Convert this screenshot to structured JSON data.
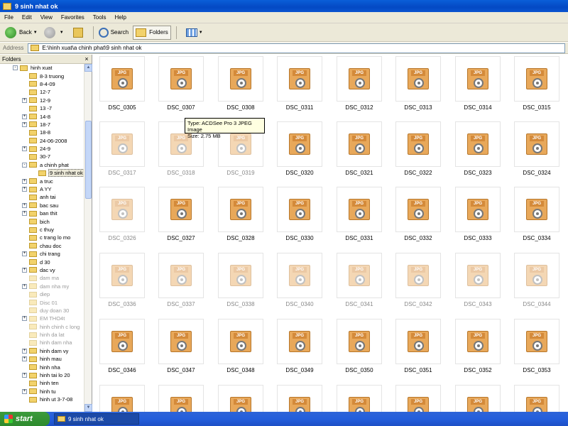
{
  "window": {
    "title": "9 sinh nhat ok"
  },
  "menu": [
    "File",
    "Edit",
    "View",
    "Favorites",
    "Tools",
    "Help"
  ],
  "toolbar": {
    "back": "Back",
    "search": "Search",
    "folders": "Folders"
  },
  "address": {
    "label": "Address",
    "path": "E:\\hinh xuat\\a chinh phat\\9 sinh nhat ok"
  },
  "folders_pane": {
    "title": "Folders",
    "close": "×"
  },
  "tree": [
    {
      "label": "hinh xuat",
      "level": 0,
      "expander": "-",
      "faded": false,
      "selected": false
    },
    {
      "label": "8-3 truong",
      "level": 1,
      "expander": "",
      "faded": false,
      "selected": false
    },
    {
      "label": "8-4-09",
      "level": 1,
      "expander": "",
      "faded": false,
      "selected": false
    },
    {
      "label": "12-7",
      "level": 1,
      "expander": "",
      "faded": false,
      "selected": false
    },
    {
      "label": "12-9",
      "level": 1,
      "expander": "+",
      "faded": false,
      "selected": false
    },
    {
      "label": "13 -7",
      "level": 1,
      "expander": "",
      "faded": false,
      "selected": false
    },
    {
      "label": "14-8",
      "level": 1,
      "expander": "+",
      "faded": false,
      "selected": false
    },
    {
      "label": "18-7",
      "level": 1,
      "expander": "+",
      "faded": false,
      "selected": false
    },
    {
      "label": "18-8",
      "level": 1,
      "expander": "",
      "faded": false,
      "selected": false
    },
    {
      "label": "24-06-2008",
      "level": 1,
      "expander": "",
      "faded": false,
      "selected": false
    },
    {
      "label": "24-9",
      "level": 1,
      "expander": "+",
      "faded": false,
      "selected": false
    },
    {
      "label": "30-7",
      "level": 1,
      "expander": "",
      "faded": false,
      "selected": false
    },
    {
      "label": "a chinh phat",
      "level": 1,
      "expander": "-",
      "faded": false,
      "selected": false
    },
    {
      "label": "9 sinh nhat ok",
      "level": 2,
      "expander": "",
      "faded": false,
      "selected": true
    },
    {
      "label": "a truc",
      "level": 1,
      "expander": "+",
      "faded": false,
      "selected": false
    },
    {
      "label": "A YY",
      "level": 1,
      "expander": "+",
      "faded": false,
      "selected": false
    },
    {
      "label": "anh tai",
      "level": 1,
      "expander": "",
      "faded": false,
      "selected": false
    },
    {
      "label": "bac sau",
      "level": 1,
      "expander": "+",
      "faded": false,
      "selected": false
    },
    {
      "label": "ban thit",
      "level": 1,
      "expander": "+",
      "faded": false,
      "selected": false
    },
    {
      "label": "bich",
      "level": 1,
      "expander": "",
      "faded": false,
      "selected": false
    },
    {
      "label": "c thuy",
      "level": 1,
      "expander": "",
      "faded": false,
      "selected": false
    },
    {
      "label": "c trang lo mo",
      "level": 1,
      "expander": "",
      "faded": false,
      "selected": false
    },
    {
      "label": "chau doc",
      "level": 1,
      "expander": "",
      "faded": false,
      "selected": false
    },
    {
      "label": "chi trang",
      "level": 1,
      "expander": "+",
      "faded": false,
      "selected": false
    },
    {
      "label": "d 30",
      "level": 1,
      "expander": "",
      "faded": false,
      "selected": false
    },
    {
      "label": "dac vy",
      "level": 1,
      "expander": "+",
      "faded": false,
      "selected": false
    },
    {
      "label": "dam ma",
      "level": 1,
      "expander": "",
      "faded": true,
      "selected": false
    },
    {
      "label": "dam nha my",
      "level": 1,
      "expander": "+",
      "faded": true,
      "selected": false
    },
    {
      "label": "diep",
      "level": 1,
      "expander": "",
      "faded": true,
      "selected": false
    },
    {
      "label": "Disc 01",
      "level": 1,
      "expander": "",
      "faded": true,
      "selected": false
    },
    {
      "label": "duy doan 30",
      "level": 1,
      "expander": "",
      "faded": true,
      "selected": false
    },
    {
      "label": "EM THO4t",
      "level": 1,
      "expander": "+",
      "faded": true,
      "selected": false
    },
    {
      "label": "hinh chinh c long",
      "level": 1,
      "expander": "",
      "faded": true,
      "selected": false
    },
    {
      "label": "hinh da lat",
      "level": 1,
      "expander": "",
      "faded": true,
      "selected": false
    },
    {
      "label": "hinh dam nha",
      "level": 1,
      "expander": "",
      "faded": true,
      "selected": false
    },
    {
      "label": "hinh dam vy",
      "level": 1,
      "expander": "+",
      "faded": false,
      "selected": false
    },
    {
      "label": "hinh mau",
      "level": 1,
      "expander": "+",
      "faded": false,
      "selected": false
    },
    {
      "label": "hinh nha",
      "level": 1,
      "expander": "",
      "faded": false,
      "selected": false
    },
    {
      "label": "hinh tai lo 20",
      "level": 1,
      "expander": "+",
      "faded": false,
      "selected": false
    },
    {
      "label": "hinh ten",
      "level": 1,
      "expander": "",
      "faded": false,
      "selected": false
    },
    {
      "label": "hinh tu",
      "level": 1,
      "expander": "+",
      "faded": false,
      "selected": false
    },
    {
      "label": "hinh ut 3-7-08",
      "level": 1,
      "expander": "",
      "faded": false,
      "selected": false
    }
  ],
  "thumb_badge": "JPG",
  "files": [
    [
      "DSC_0305",
      "DSC_0307",
      "DSC_0308",
      "DSC_0311",
      "DSC_0312",
      "DSC_0313",
      "DSC_0314",
      "DSC_0315"
    ],
    [
      "DSC_0317",
      "DSC_0318",
      "DSC_0319",
      "DSC_0320",
      "DSC_0321",
      "DSC_0322",
      "DSC_0323",
      "DSC_0324"
    ],
    [
      "DSC_0326",
      "DSC_0327",
      "DSC_0328",
      "DSC_0330",
      "DSC_0331",
      "DSC_0332",
      "DSC_0333",
      "DSC_0334"
    ],
    [
      "DSC_0336",
      "DSC_0337",
      "DSC_0338",
      "DSC_0340",
      "DSC_0341",
      "DSC_0342",
      "DSC_0343",
      "DSC_0344"
    ],
    [
      "DSC_0346",
      "DSC_0347",
      "DSC_0348",
      "DSC_0349",
      "DSC_0350",
      "DSC_0351",
      "DSC_0352",
      "DSC_0353"
    ],
    [
      "",
      "",
      "",
      "",
      "",
      "",
      "",
      ""
    ]
  ],
  "faded_rows": [
    3
  ],
  "faded_cells": [
    "1-0",
    "1-1",
    "1-2",
    "2-0"
  ],
  "tooltip": {
    "type": "Type: ACDSee Pro 3 JPEG Image",
    "size": "Size: 2.75 MB"
  },
  "taskbar": {
    "start": "start",
    "task": "9 sinh nhat ok"
  }
}
